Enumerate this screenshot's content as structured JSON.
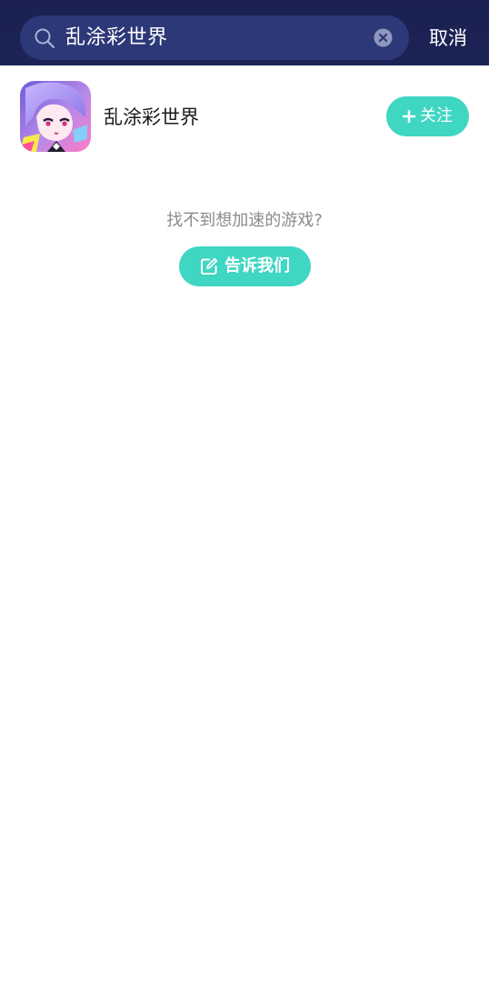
{
  "search": {
    "query": "乱涂彩世界",
    "icon": "search-icon",
    "clear_icon": "clear-icon"
  },
  "header": {
    "cancel_label": "取消"
  },
  "result": {
    "game_name": "乱涂彩世界",
    "follow_label": "关注",
    "follow_icon": "plus-icon"
  },
  "empty_hint": {
    "text": "找不到想加速的游戏?",
    "button_label": "告诉我们",
    "button_icon": "edit-icon"
  },
  "colors": {
    "header_bg": "#1c2456",
    "search_bg": "#2c3878",
    "accent": "#3fd6c2"
  }
}
